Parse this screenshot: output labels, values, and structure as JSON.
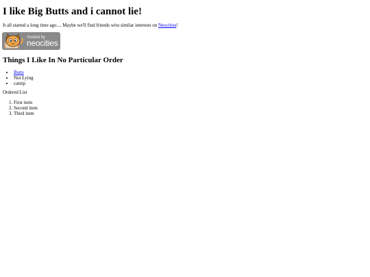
{
  "page": {
    "title": "I like Big Butts and i cannot lie!"
  },
  "intro": {
    "text_before_link": "It all started a long time ago.... Maybe we'll find friends witu similar interests on ",
    "link_text": "Neocities",
    "text_after_link": "!"
  },
  "badge": {
    "hosted_by": "hosted by",
    "brand": "neocities",
    "icon": "neocities-cat-mascot-icon"
  },
  "likes": {
    "heading": "Things I Like In No Particular Order",
    "items": [
      {
        "label": "Butts",
        "is_link": true
      },
      {
        "label": "Not Lying",
        "is_link": false
      },
      {
        "label": "catnip",
        "is_link": false
      }
    ]
  },
  "ordered": {
    "label": "Ordered List",
    "items": [
      "First item",
      "Second item",
      "Third item"
    ]
  },
  "colors": {
    "link": "#0000ee",
    "badge_background": "#8a8a8a",
    "mascot": "#f0a64a"
  }
}
